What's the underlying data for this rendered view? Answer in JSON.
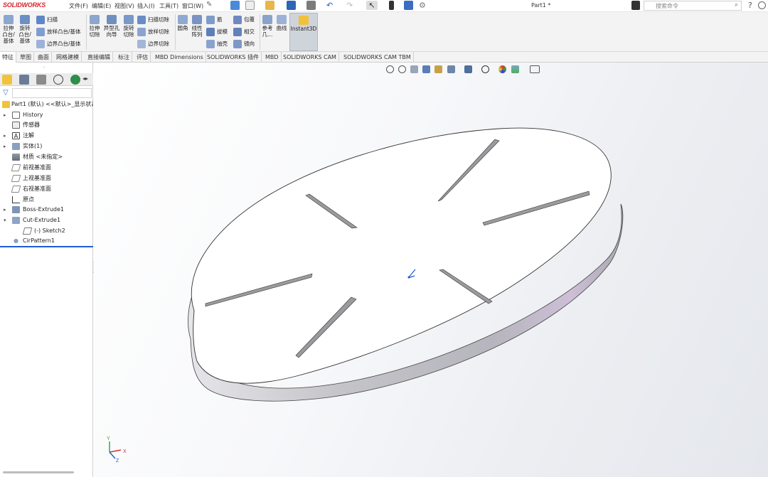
{
  "app": {
    "logo_text": "SOLIDWORKS",
    "doc_title": "Part1 *"
  },
  "menu": [
    "文件(F)",
    "编辑(E)",
    "视图(V)",
    "插入(I)",
    "工具(T)",
    "窗口(W)"
  ],
  "search": {
    "placeholder": "搜索命令"
  },
  "ribbon": {
    "extrude_boss": "拉伸\n凸台/\n基体",
    "revolve_boss": "旋转\n凸台/\n基体",
    "sweep": "扫描",
    "loft_boss": "放样凸台/基体",
    "boundary_boss": "边界凸台/基体",
    "extrude_cut": "拉伸\n切除",
    "hole_wizard": "异型孔\n向导",
    "revolve_cut": "旋转\n切除",
    "swept_cut": "扫描切除",
    "lofted_cut": "放样切除",
    "boundary_cut": "边界切除",
    "fillet": "圆角",
    "linear_pattern": "线性\n阵列",
    "rib": "筋",
    "draft": "拔模",
    "shell": "抽壳",
    "wrap": "包覆",
    "intersect": "相交",
    "mirror": "镜向",
    "reference_geometry": "参考\n几...",
    "curves": "曲线",
    "instant3d": "Instant3D"
  },
  "tabs": [
    "特征",
    "草图",
    "曲面",
    "网格建模",
    "直接编辑",
    "标注",
    "评估",
    "MBD Dimensions",
    "SOLIDWORKS 插件",
    "MBD",
    "SOLIDWORKS CAM",
    "SOLIDWORKS CAM TBM"
  ],
  "tree": {
    "root": "Part1 (默认) <<默认>_显示状态",
    "items": [
      "History",
      "传感器",
      "注解",
      "实体(1)",
      "材质 <未指定>",
      "前视基准面",
      "上视基准面",
      "右视基准面",
      "原点",
      "Boss-Extrude1",
      "Cut-Extrude1",
      "(-) Sketch2",
      "CirPattern1"
    ]
  },
  "triad": {
    "x_label": "X",
    "y_label": "Y",
    "z_label": "Z"
  },
  "colors": {
    "accent": "#1e5bd6",
    "logo_red": "#d6262a",
    "active_tab": "#ffffff",
    "part_side": "#b9b9be"
  }
}
